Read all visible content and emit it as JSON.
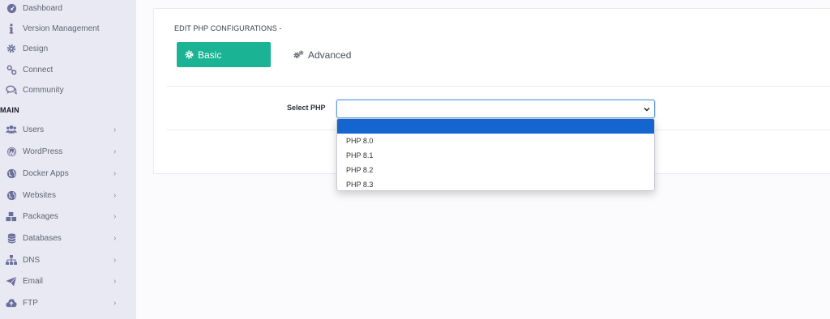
{
  "sidebar": {
    "items_top": [
      {
        "label": "Dashboard",
        "icon": "dashboard-icon"
      },
      {
        "label": "Version Management",
        "icon": "info-icon"
      },
      {
        "label": "Design",
        "icon": "gear-icon"
      },
      {
        "label": "Connect",
        "icon": "link-icon"
      },
      {
        "label": "Community",
        "icon": "chat-icon"
      }
    ],
    "section": "MAIN",
    "items_main": [
      {
        "label": "Users",
        "icon": "users-icon",
        "chevron": "›"
      },
      {
        "label": "WordPress",
        "icon": "wordpress-icon",
        "chevron": "›"
      },
      {
        "label": "Docker Apps",
        "icon": "globe-icon",
        "chevron": "›"
      },
      {
        "label": "Websites",
        "icon": "globe-icon",
        "chevron": "›"
      },
      {
        "label": "Packages",
        "icon": "cubes-icon",
        "chevron": "›"
      },
      {
        "label": "Databases",
        "icon": "database-icon",
        "chevron": "›"
      },
      {
        "label": "DNS",
        "icon": "sitemap-icon",
        "chevron": "›"
      },
      {
        "label": "Email",
        "icon": "paper-plane-icon",
        "chevron": "›"
      },
      {
        "label": "FTP",
        "icon": "cloud-upload-icon",
        "chevron": "›"
      }
    ]
  },
  "main": {
    "title": "EDIT PHP CONFIGURATIONS -",
    "tabs": {
      "basic": "Basic",
      "advanced": "Advanced"
    },
    "select_php": {
      "label": "Select PHP",
      "value": "",
      "options": [
        "",
        "PHP 8.0",
        "PHP 8.1",
        "PHP 8.2",
        "PHP 8.3"
      ]
    }
  },
  "colors": {
    "accent": "#1ab394",
    "sidebar_bg": "#e9e9f3",
    "icon": "#6b6f9b",
    "selected_option": "#1565d0"
  }
}
